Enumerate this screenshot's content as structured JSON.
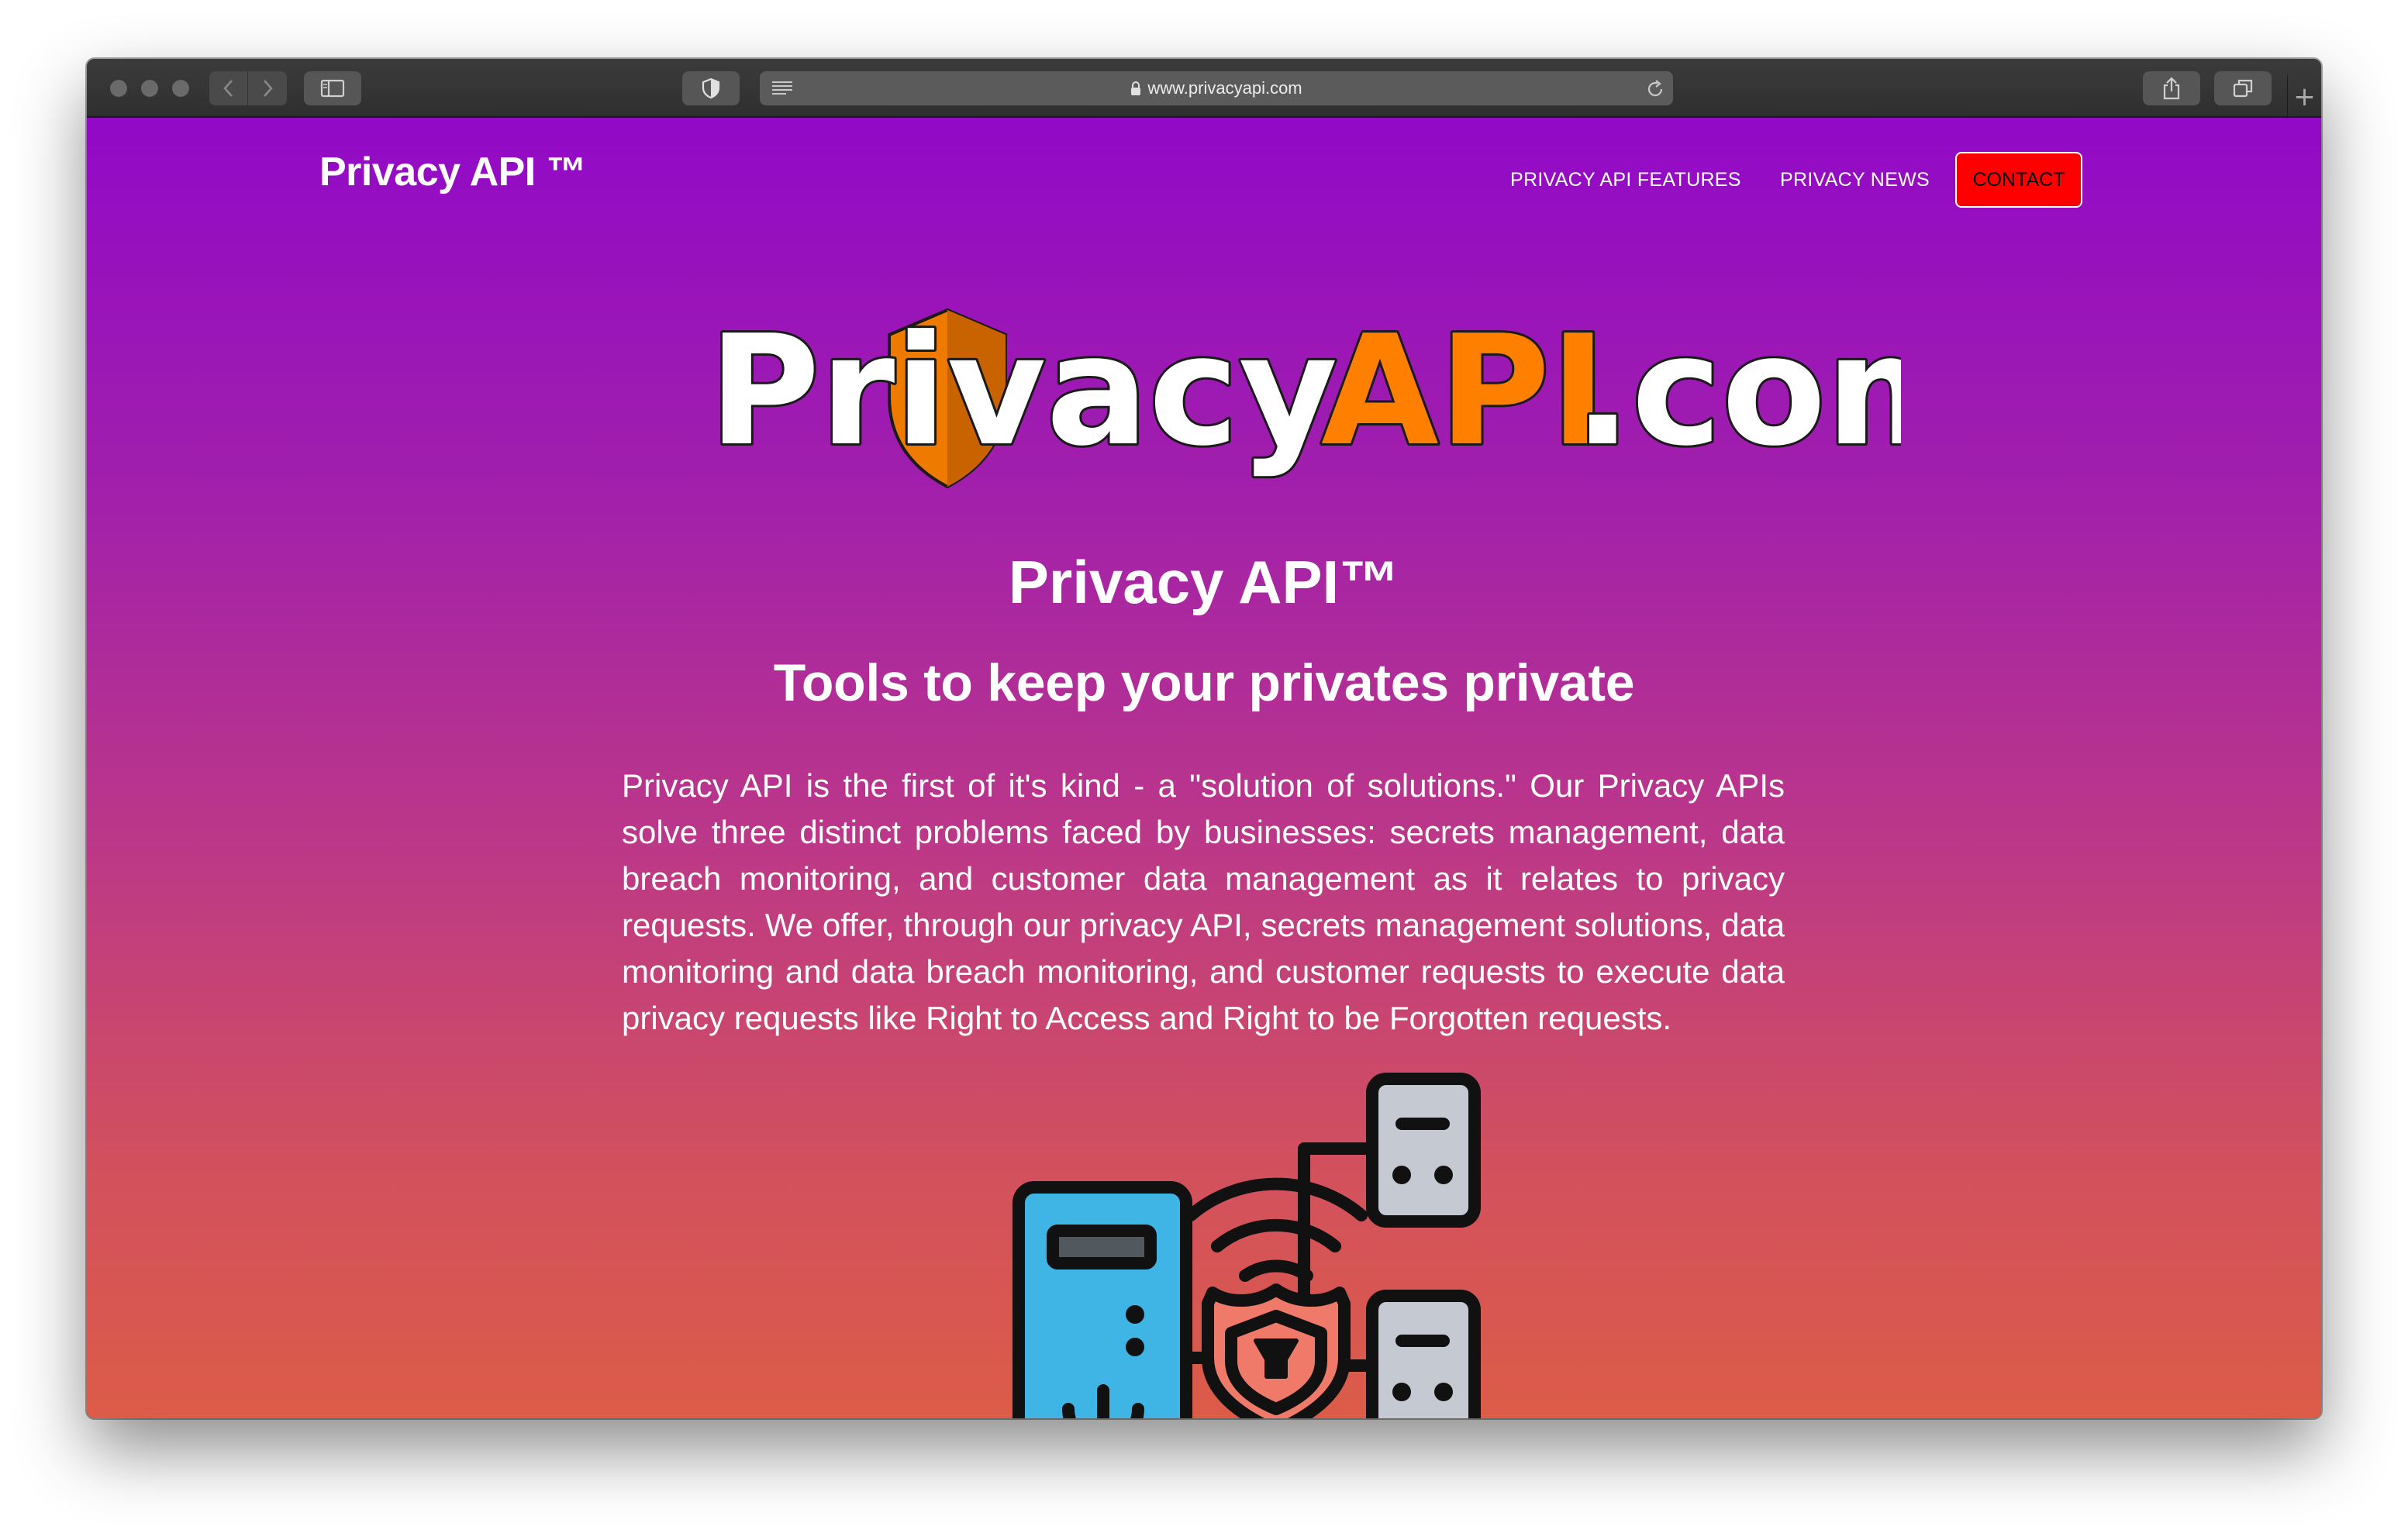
{
  "browser": {
    "url": "www.privacyapi.com",
    "icons": {
      "back": "chevron-left-icon",
      "forward": "chevron-right-icon",
      "sidebar": "sidebar-icon",
      "privacy": "shield-icon",
      "reader": "reader-icon",
      "lock": "lock-icon",
      "reload": "reload-icon",
      "share": "share-icon",
      "tabs": "tabs-icon",
      "new_tab": "plus-icon"
    }
  },
  "site": {
    "brand": "Privacy API ™",
    "nav": {
      "features": "PRIVACY API FEATURES",
      "news": "PRIVACY NEWS",
      "contact": "CONTACT"
    },
    "logo": {
      "part1": "Privacy",
      "part2": "API",
      "part3": ".com"
    },
    "subtitle": "Privacy API™",
    "tagline": "Tools to keep your privates private",
    "description": "Privacy API is the first of it's kind - a \"solution of solutions.\" Our Privacy APIs solve three distinct problems faced by businesses: secrets management, data breach monitoring, and customer data management as it relates to privacy requests. We offer, through our privacy API, secrets management solutions, data monitoring and data breach monitoring, and customer requests to execute data privacy requests like Right to Access and Right to be Forgotten requests."
  },
  "colors": {
    "gradient_top": "#9209c7",
    "gradient_bottom": "#dc5c48",
    "contact_bg": "#ff0000",
    "logo_accent": "#ff7f00",
    "server_blue": "#3fb5e6",
    "shield_red": "#f07a6a"
  }
}
